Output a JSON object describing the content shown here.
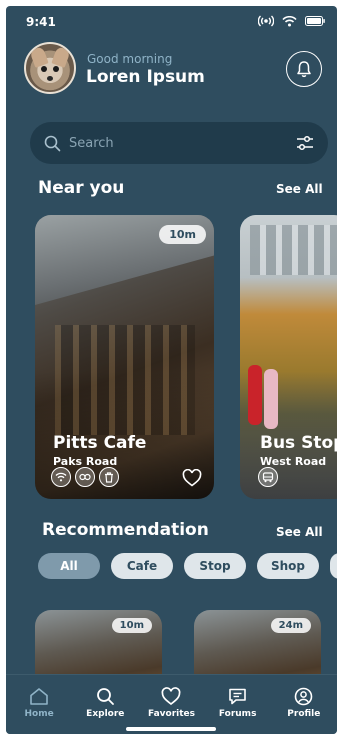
{
  "status_bar": {
    "time": "9:41"
  },
  "header": {
    "greeting": "Good morning",
    "name": "Loren Ipsum"
  },
  "search": {
    "placeholder": "Search"
  },
  "near_you": {
    "title": "Near you",
    "see_all": "See All",
    "cards": [
      {
        "title": "Pitts Cafe",
        "subtitle": "Paks Road",
        "distance": "10m",
        "icons": [
          "wifi-icon",
          "parking-icon",
          "trash-icon"
        ]
      },
      {
        "title": "Bus Stop",
        "subtitle": "West Road",
        "icons": [
          "bus-icon"
        ]
      }
    ]
  },
  "recommendation": {
    "title": "Recommendation",
    "see_all": "See All",
    "chips": [
      "All",
      "Cafe",
      "Stop",
      "Shop"
    ],
    "cards": [
      {
        "distance": "10m"
      },
      {
        "distance": "24m"
      }
    ]
  },
  "nav": {
    "items": [
      {
        "label": "Home",
        "icon": "home-icon"
      },
      {
        "label": "Explore",
        "icon": "search-icon"
      },
      {
        "label": "Favorites",
        "icon": "heart-icon"
      },
      {
        "label": "Forums",
        "icon": "chat-icon"
      },
      {
        "label": "Profile",
        "icon": "profile-icon"
      }
    ]
  },
  "colors": {
    "background": "#2f4d5f",
    "accent": "#8fb3c7",
    "chip_active": "#7f9aab"
  }
}
